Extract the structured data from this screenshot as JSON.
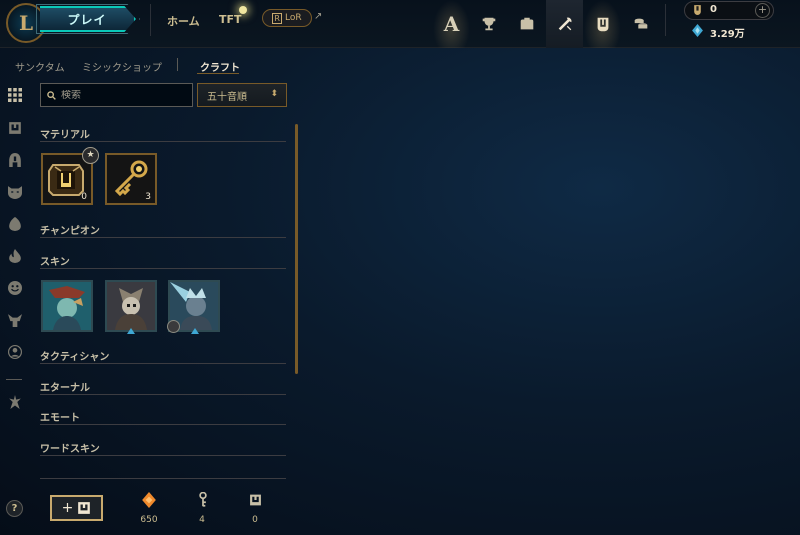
{
  "topbar": {
    "play_label": "プレイ",
    "nav": {
      "home": "ホーム",
      "tft": "TFT",
      "lor": "LoR",
      "lor_box": "R"
    },
    "tabs": [
      {
        "name": "profile-tab",
        "icon": "letter-a-icon"
      },
      {
        "name": "collection-tab",
        "icon": "trophy-icon"
      },
      {
        "name": "store-tab",
        "icon": "backpack-icon"
      },
      {
        "name": "loot-tab",
        "icon": "crafting-tools-icon",
        "active": true
      },
      {
        "name": "missions-tab",
        "icon": "chest-icon"
      },
      {
        "name": "coins-tab",
        "icon": "coin-stack-icon"
      }
    ],
    "currency": {
      "rp": "0",
      "be": "3.29万"
    }
  },
  "subnav": {
    "sanctum": "サンクタム",
    "mythic_shop": "ミシックショップ",
    "craft": "クラフト"
  },
  "search": {
    "placeholder": "検索"
  },
  "sort": {
    "selected": "五十音順"
  },
  "categories": {
    "material": "マテリアル",
    "champion": "チャンピオン",
    "skin": "スキン",
    "tactician": "タクティシャン",
    "eternal": "エターナル",
    "emote": "エモート",
    "ward": "ワードスキン"
  },
  "materials": [
    {
      "name": "hextech-chest",
      "count": "0"
    },
    {
      "name": "hextech-key",
      "count": "3"
    }
  ],
  "footer": {
    "orange_essence": "650",
    "key_fragments": "4",
    "chests": "0",
    "add_label": "+"
  },
  "colors": {
    "gold": "#c8aa6e",
    "gold_dark": "#785a28",
    "teal": "#0ac8b9",
    "orange_essence": "#f08a2c",
    "blue_essence": "#3fa8d4"
  }
}
